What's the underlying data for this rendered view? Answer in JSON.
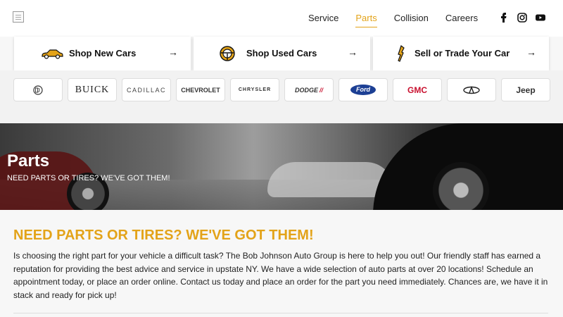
{
  "nav": {
    "items": [
      "Service",
      "Parts",
      "Collision",
      "Careers"
    ],
    "active_index": 1
  },
  "social": {
    "icons": [
      "facebook-icon",
      "instagram-icon",
      "youtube-icon"
    ]
  },
  "cards": [
    {
      "label": "Shop New Cars",
      "icon": "car-icon"
    },
    {
      "label": "Shop Used Cars",
      "icon": "steering-wheel-icon"
    },
    {
      "label": "Sell or Trade Your Car",
      "icon": "key-icon"
    }
  ],
  "brands": [
    "Alfa Romeo",
    "BUICK",
    "CADILLAC",
    "CHEVROLET",
    "CHRYSLER",
    "DODGE",
    "Ford",
    "GMC",
    "INFINITI",
    "Jeep"
  ],
  "hero": {
    "title": "Parts",
    "subtitle": "NEED PARTS OR TIRES? WE'VE GOT THEM!"
  },
  "content": {
    "heading": "NEED PARTS OR TIRES? WE'VE GOT THEM!",
    "body": "Is choosing the right part for your vehicle a difficult task? The Bob Johnson Auto Group is here to help you out! Our friendly staff has earned a reputation for providing the best advice and service in upstate NY. We have a wide selection of auto parts at over 20 locations! Schedule an appointment today, or place an order online. Contact us today and place an order for the part you need immediately. Chances are, we have it in stack and ready for pick up!"
  },
  "colors": {
    "accent": "#e3a319",
    "ford_blue": "#1c3f94",
    "gmc_red": "#c8102e"
  }
}
